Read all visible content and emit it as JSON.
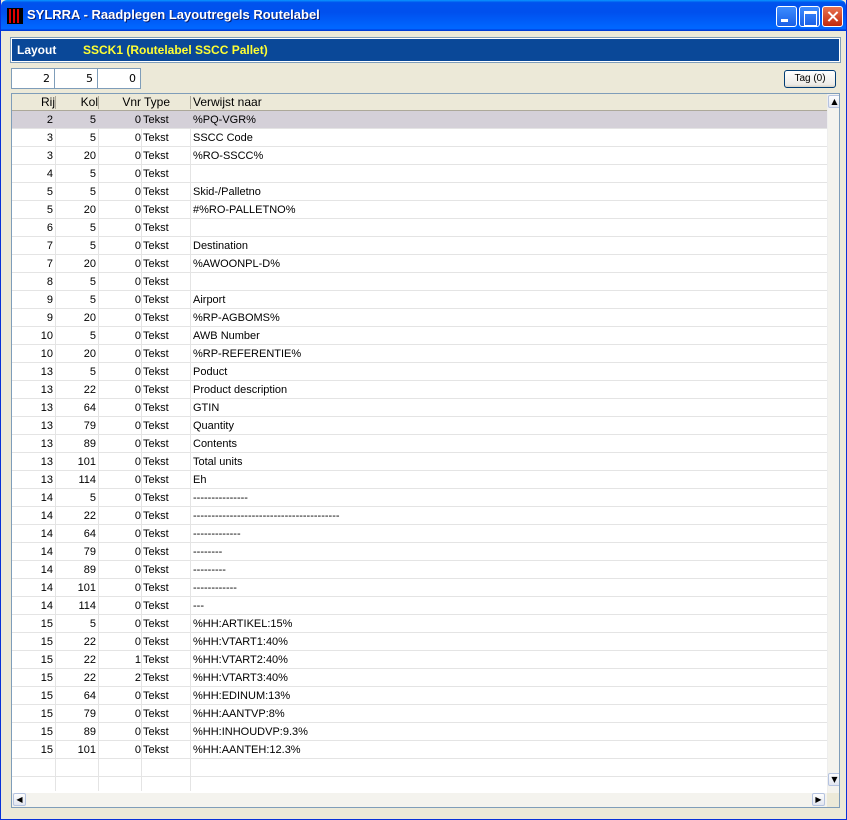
{
  "window": {
    "title": "SYLRRA - Raadplegen Layoutregels Routelabel"
  },
  "layout": {
    "label": "Layout",
    "name": "SSCK1  (Routelabel SSCC Pallet)"
  },
  "filters": {
    "rij": "2",
    "kol": "5",
    "vnr": "0"
  },
  "tag_button": "Tag (0)",
  "columns": {
    "rij": "Rij",
    "kol": "Kol",
    "vnr": "Vnr",
    "type": "Type",
    "ref": "Verwijst naar"
  },
  "rows": [
    {
      "rij": "2",
      "kol": "5",
      "vnr": "0",
      "type": "Tekst",
      "ref": "%PQ-VGR%"
    },
    {
      "rij": "3",
      "kol": "5",
      "vnr": "0",
      "type": "Tekst",
      "ref": "SSCC Code"
    },
    {
      "rij": "3",
      "kol": "20",
      "vnr": "0",
      "type": "Tekst",
      "ref": "%RO-SSCC%"
    },
    {
      "rij": "4",
      "kol": "5",
      "vnr": "0",
      "type": "Tekst",
      "ref": ""
    },
    {
      "rij": "5",
      "kol": "5",
      "vnr": "0",
      "type": "Tekst",
      "ref": "Skid-/Palletno"
    },
    {
      "rij": "5",
      "kol": "20",
      "vnr": "0",
      "type": "Tekst",
      "ref": "#%RO-PALLETNO%"
    },
    {
      "rij": "6",
      "kol": "5",
      "vnr": "0",
      "type": "Tekst",
      "ref": ""
    },
    {
      "rij": "7",
      "kol": "5",
      "vnr": "0",
      "type": "Tekst",
      "ref": "Destination"
    },
    {
      "rij": "7",
      "kol": "20",
      "vnr": "0",
      "type": "Tekst",
      "ref": "%AWOONPL-D%"
    },
    {
      "rij": "8",
      "kol": "5",
      "vnr": "0",
      "type": "Tekst",
      "ref": ""
    },
    {
      "rij": "9",
      "kol": "5",
      "vnr": "0",
      "type": "Tekst",
      "ref": "Airport"
    },
    {
      "rij": "9",
      "kol": "20",
      "vnr": "0",
      "type": "Tekst",
      "ref": "%RP-AGBOMS%"
    },
    {
      "rij": "10",
      "kol": "5",
      "vnr": "0",
      "type": "Tekst",
      "ref": "AWB Number"
    },
    {
      "rij": "10",
      "kol": "20",
      "vnr": "0",
      "type": "Tekst",
      "ref": "%RP-REFERENTIE%"
    },
    {
      "rij": "13",
      "kol": "5",
      "vnr": "0",
      "type": "Tekst",
      "ref": "Poduct"
    },
    {
      "rij": "13",
      "kol": "22",
      "vnr": "0",
      "type": "Tekst",
      "ref": "Product description"
    },
    {
      "rij": "13",
      "kol": "64",
      "vnr": "0",
      "type": "Tekst",
      "ref": "GTIN"
    },
    {
      "rij": "13",
      "kol": "79",
      "vnr": "0",
      "type": "Tekst",
      "ref": "Quantity"
    },
    {
      "rij": "13",
      "kol": "89",
      "vnr": "0",
      "type": "Tekst",
      "ref": " Contents"
    },
    {
      "rij": "13",
      "kol": "101",
      "vnr": "0",
      "type": "Tekst",
      "ref": " Total units"
    },
    {
      "rij": "13",
      "kol": "114",
      "vnr": "0",
      "type": "Tekst",
      "ref": "Eh"
    },
    {
      "rij": "14",
      "kol": "5",
      "vnr": "0",
      "type": "Tekst",
      "ref": "---------------"
    },
    {
      "rij": "14",
      "kol": "22",
      "vnr": "0",
      "type": "Tekst",
      "ref": "----------------------------------------"
    },
    {
      "rij": "14",
      "kol": "64",
      "vnr": "0",
      "type": "Tekst",
      "ref": "-------------"
    },
    {
      "rij": "14",
      "kol": "79",
      "vnr": "0",
      "type": "Tekst",
      "ref": "--------"
    },
    {
      "rij": "14",
      "kol": "89",
      "vnr": "0",
      "type": "Tekst",
      "ref": "---------"
    },
    {
      "rij": "14",
      "kol": "101",
      "vnr": "0",
      "type": "Tekst",
      "ref": "------------"
    },
    {
      "rij": "14",
      "kol": "114",
      "vnr": "0",
      "type": "Tekst",
      "ref": "---"
    },
    {
      "rij": "15",
      "kol": "5",
      "vnr": "0",
      "type": "Tekst",
      "ref": "%HH:ARTIKEL:15%"
    },
    {
      "rij": "15",
      "kol": "22",
      "vnr": "0",
      "type": "Tekst",
      "ref": "%HH:VTART1:40%"
    },
    {
      "rij": "15",
      "kol": "22",
      "vnr": "1",
      "type": "Tekst",
      "ref": "%HH:VTART2:40%"
    },
    {
      "rij": "15",
      "kol": "22",
      "vnr": "2",
      "type": "Tekst",
      "ref": "%HH:VTART3:40%"
    },
    {
      "rij": "15",
      "kol": "64",
      "vnr": "0",
      "type": "Tekst",
      "ref": "%HH:EDINUM:13%"
    },
    {
      "rij": "15",
      "kol": "79",
      "vnr": "0",
      "type": "Tekst",
      "ref": "%HH:AANTVP:8%"
    },
    {
      "rij": "15",
      "kol": "89",
      "vnr": "0",
      "type": "Tekst",
      "ref": "%HH:INHOUDVP:9.3%"
    },
    {
      "rij": "15",
      "kol": "101",
      "vnr": "0",
      "type": "Tekst",
      "ref": "%HH:AANTEH:12.3%"
    }
  ],
  "selected_row": 0,
  "colors": {
    "title_bar": "#0050ee",
    "layout_band": "#0a4898",
    "layout_name": "#ffff33",
    "selected_row": "#d4d0d8"
  },
  "icons": {
    "app": "app-icon",
    "minimize": "minimize-icon",
    "maximize": "maximize-icon",
    "close": "close-icon"
  }
}
